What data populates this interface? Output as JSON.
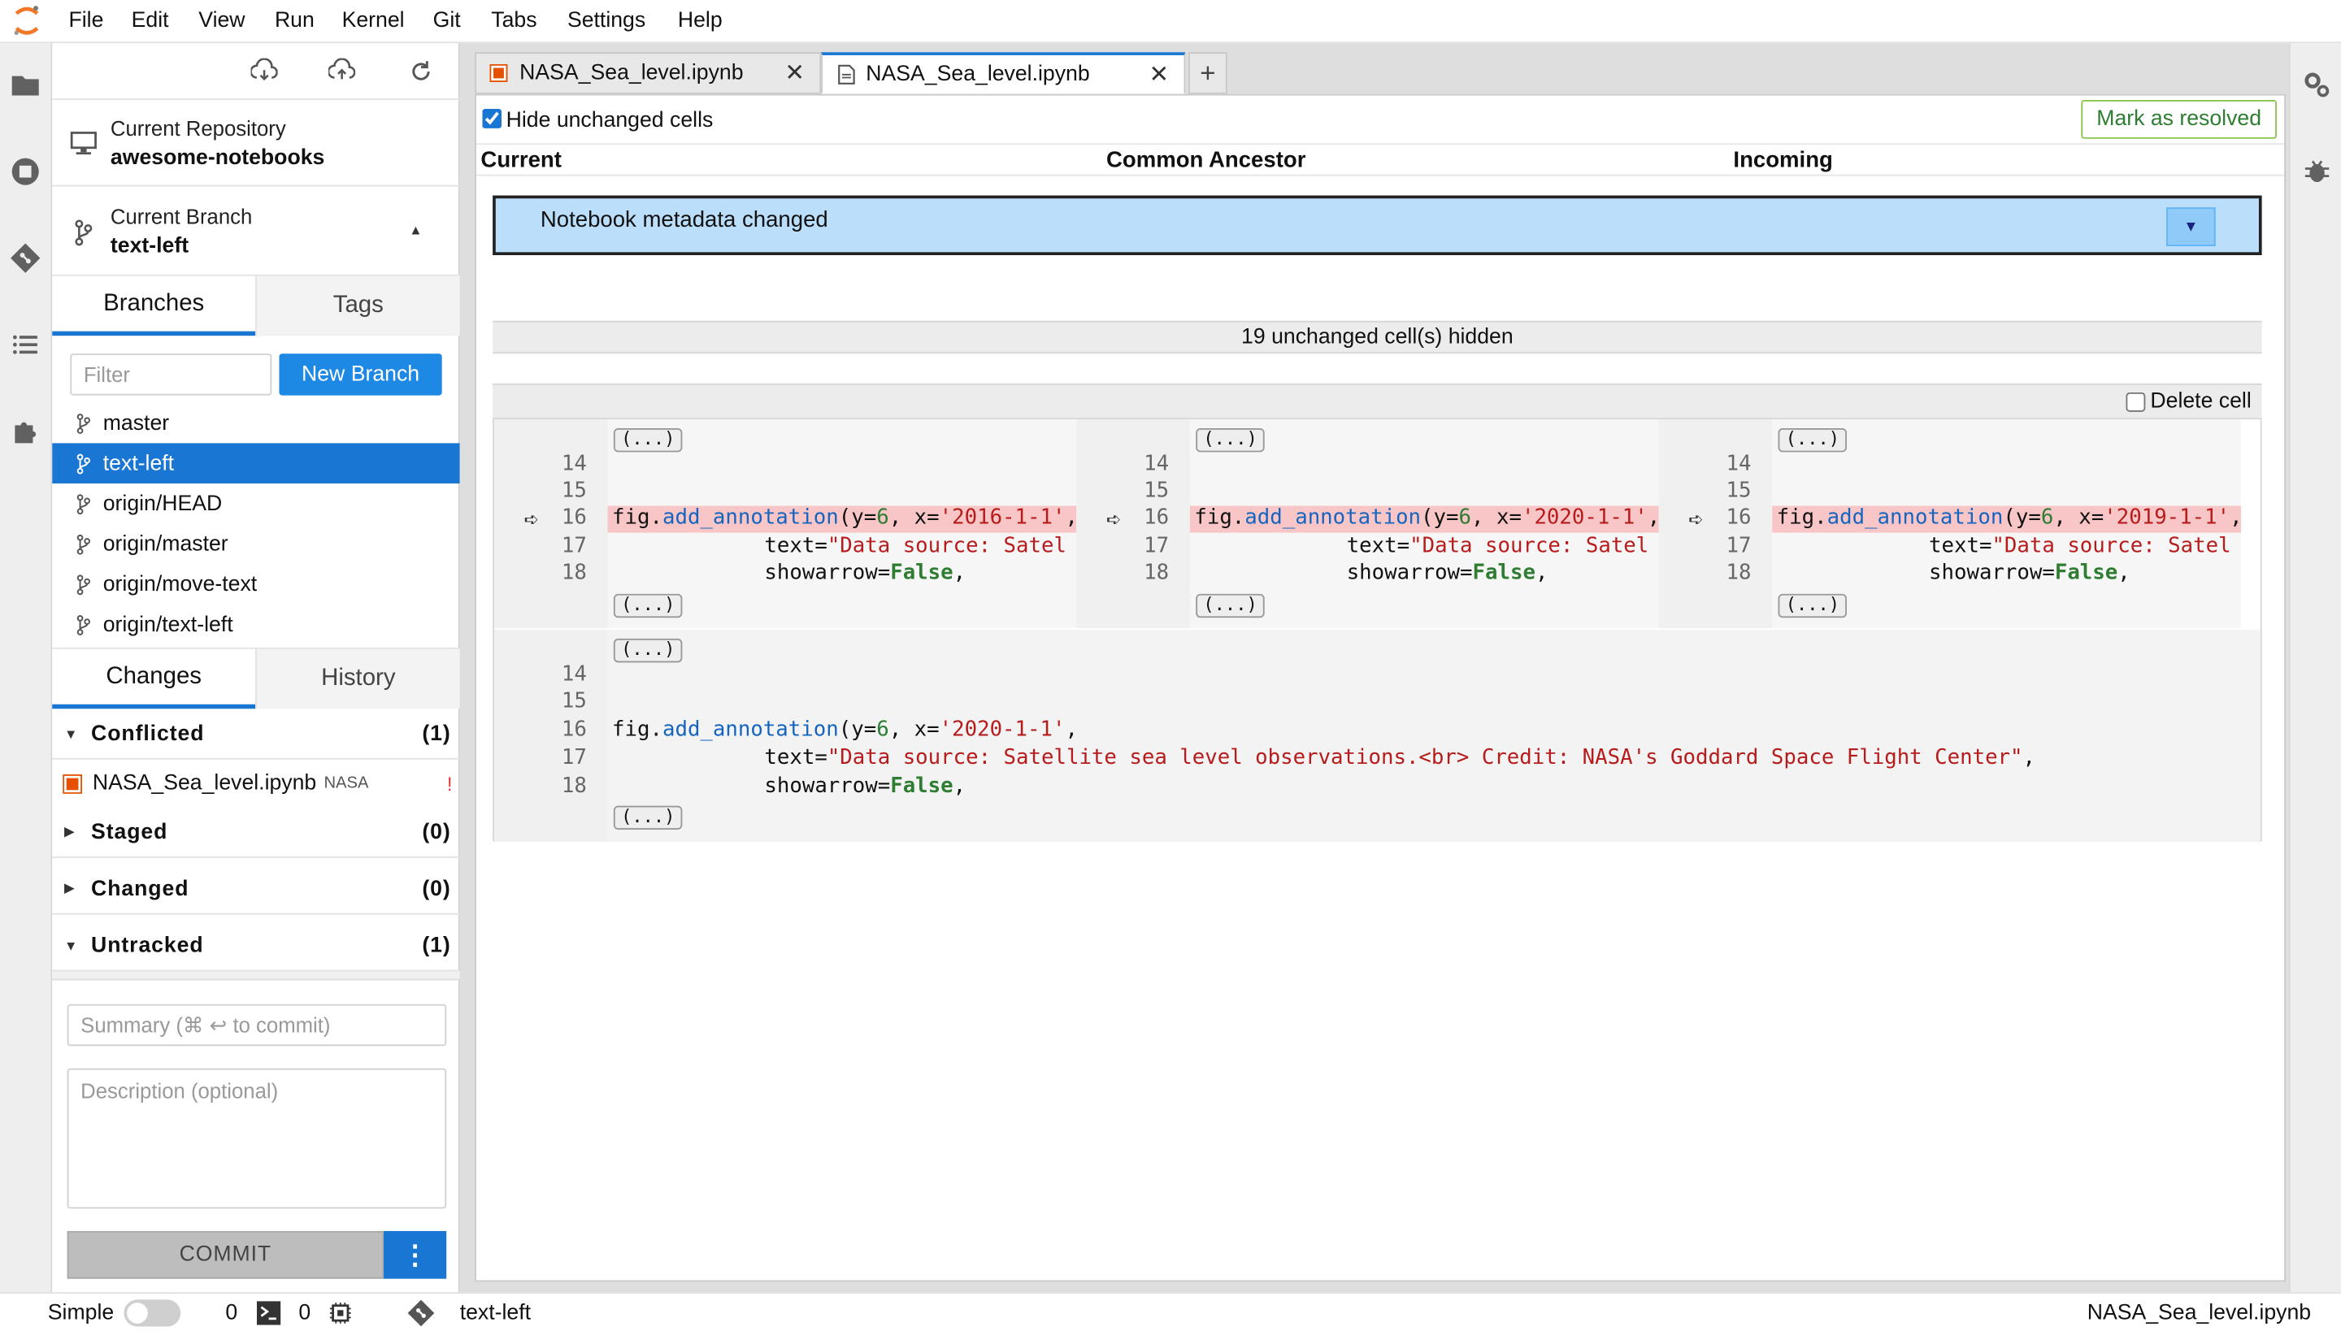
{
  "menu": [
    "File",
    "Edit",
    "View",
    "Run",
    "Kernel",
    "Git",
    "Tabs",
    "Settings",
    "Help"
  ],
  "git_panel": {
    "current_repository_label": "Current Repository",
    "current_repository": "awesome-notebooks",
    "current_branch_label": "Current Branch",
    "current_branch": "text-left",
    "branch_tabs": [
      "Branches",
      "Tags"
    ],
    "filter_placeholder": "Filter",
    "new_branch_label": "New Branch",
    "branches": [
      "master",
      "text-left",
      "origin/HEAD",
      "origin/master",
      "origin/move-text",
      "origin/text-left"
    ],
    "active_branch_index": 1,
    "changes_tabs": [
      "Changes",
      "History"
    ],
    "sections": {
      "conflicted": {
        "label": "Conflicted",
        "count": "(1)"
      },
      "staged": {
        "label": "Staged",
        "count": "(0)"
      },
      "changed": {
        "label": "Changed",
        "count": "(0)"
      },
      "untracked": {
        "label": "Untracked",
        "count": "(1)"
      }
    },
    "conflicted_file": {
      "name": "NASA_Sea_level.ipynb",
      "path": "NASA",
      "status": "!"
    },
    "summary_placeholder": "Summary (⌘ ↩ to commit)",
    "description_placeholder": "Description (optional)",
    "commit_label": "COMMIT",
    "commit_more_label": "⋮"
  },
  "tabs": [
    {
      "label": "NASA_Sea_level.ipynb",
      "close": "✕"
    },
    {
      "label": "NASA_Sea_level.ipynb",
      "close": "✕"
    }
  ],
  "add_tab_label": "+",
  "merge_view": {
    "hide_unchanged_label": "Hide unchanged cells",
    "hide_unchanged_checked": true,
    "mark_resolved_label": "Mark as resolved",
    "columns": [
      "Current",
      "Common Ancestor",
      "Incoming"
    ],
    "metadata_changed_label": "Notebook metadata changed",
    "unchanged_hidden_label": "19 unchanged cell(s) hidden",
    "delete_cell_label": "Delete cell",
    "ellipsis_label": "(...)",
    "line_numbers": [
      "14",
      "15",
      "16",
      "17",
      "18"
    ],
    "panes": [
      {
        "date": "2016-1-1"
      },
      {
        "date": "2020-1-1"
      },
      {
        "date": "2019-1-1"
      }
    ],
    "code": {
      "line16_prefix": "fig.",
      "line16_fn": "add_annotation",
      "line16_args_a": "(y=",
      "line16_num": "6",
      "line16_args_b": ", x=",
      "line17_text": "text=",
      "line17_short_str": "\"Data source: Satel",
      "line17_full_str": "\"Data source: Satellite sea level observations.<br> Credit: NASA's Goddard Space Flight Center\"",
      "line18_text": "showarrow=",
      "line18_kw": "False",
      "comma": ","
    },
    "result_date": "2020-1-1"
  },
  "status_bar": {
    "mode_label": "Simple",
    "terminals": "0",
    "kernels": "0",
    "branch": "text-left",
    "file": "NASA_Sea_level.ipynb"
  },
  "colors": {
    "accent": "#1976d2",
    "metadata_bg": "#bbdefb",
    "conflict_highlight": "#f8c6c6",
    "resolve_green": "#2e7d32"
  }
}
